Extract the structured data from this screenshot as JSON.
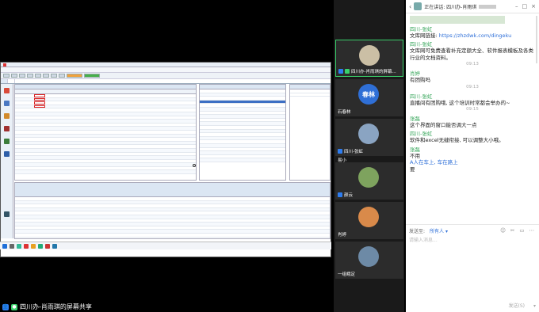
{
  "top_title": "",
  "shared_app": {
    "title": "",
    "menus": [
      "",
      "",
      "",
      "",
      "",
      "",
      ""
    ],
    "tabs": [
      "",
      ""
    ],
    "nav": [
      "",
      "",
      "",
      "",
      "",
      "",
      ""
    ]
  },
  "share_bar": {
    "label": "四川办-肖雨琪的屏幕共享"
  },
  "participants": [
    {
      "name": "四川办-肖雨琪的屏幕...",
      "avatar_text": "",
      "active": true
    },
    {
      "name": "石春林",
      "avatar_text": "春林",
      "active": false
    },
    {
      "name": "四川-张虹",
      "avatar_text": "",
      "active": false
    },
    {
      "name": "易小",
      "avatar_text": "",
      "active": false
    },
    {
      "name": "颜云",
      "avatar_text": "",
      "active": false
    },
    {
      "name": "肖婷",
      "avatar_text": "",
      "active": false
    },
    {
      "name": "一组峨定",
      "avatar_text": "",
      "active": false
    }
  ],
  "chat": {
    "header_title": "正在讲话: 四川办-肖雨琪",
    "messages": [
      {
        "sender": "四川-张虹",
        "text": "文库网链接: ",
        "link": "https://zhzdwk.com/dingeku"
      },
      {
        "sender": "四川-张虹",
        "text": "文库网可免费查看补充定额大全、软件报表模板及各类行业的文档资料。"
      },
      {
        "time": "09:13"
      },
      {
        "sender": "肖婷",
        "text": "有团购吗"
      },
      {
        "time": "09:13"
      },
      {
        "sender": "四川-张虹",
        "text": "直播间有团购哦, 这个培训时常都会举办的~"
      },
      {
        "time": "09:15"
      },
      {
        "sender": "张磊",
        "text": "这个界面的窗口能否调大一点"
      },
      {
        "sender": "四川-张虹",
        "text": "软件和excel无缝衔接, 可以调整大小哦。"
      },
      {
        "sender": "张磊",
        "text": "不用"
      },
      {
        "sender": "",
        "text": "A人在车上, 车在路上",
        "style": "blue"
      },
      {
        "sender": "",
        "text": "要"
      }
    ],
    "send_to_label": "发送至:",
    "send_to_value": "所有人 ▾",
    "input_placeholder": "请输入消息...",
    "send_button": "发送(S)",
    "more_button": "▾"
  },
  "colors": {
    "accent_green": "#3ad06b",
    "sender_green": "#3aa75d",
    "link_blue": "#2e6fd8"
  },
  "icons": [
    "back-icon",
    "minimize-icon",
    "maximize-icon",
    "close-icon",
    "emoji-icon",
    "screenshot-icon",
    "file-icon",
    "more-icon",
    "user-icon",
    "mic-icon"
  ]
}
